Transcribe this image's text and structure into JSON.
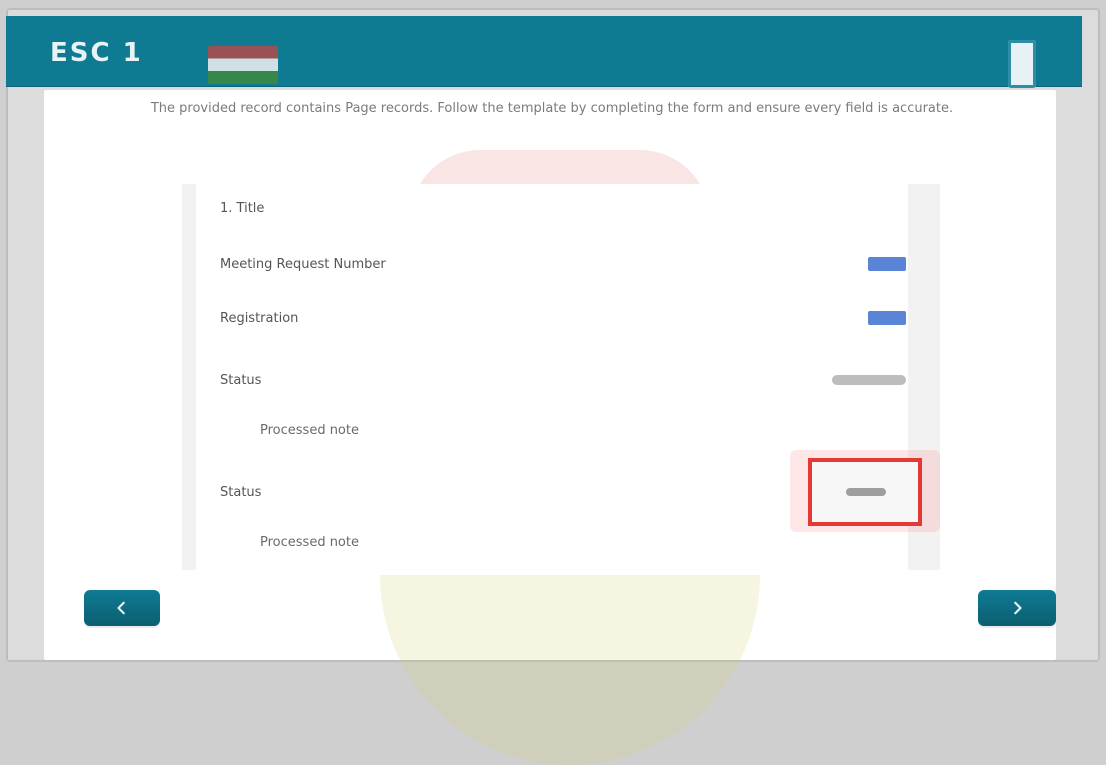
{
  "header": {
    "title": "ESC 1",
    "flag_icon": "flag-icon",
    "right_icon": "document-icon"
  },
  "instruction": {
    "text": "The provided record contains Page records. Follow the template by completing the form and ensure every field is accurate."
  },
  "form": {
    "items": [
      {
        "label": "1. Title",
        "value_type": "none"
      },
      {
        "label": "Meeting Request Number",
        "value_type": "pill",
        "value": ""
      },
      {
        "label": "Registration",
        "value_type": "pill",
        "value": ""
      },
      {
        "label": "Status",
        "value_type": "line",
        "value": ""
      },
      {
        "label": "Processed note",
        "value_type": "none",
        "indent": true
      },
      {
        "label": "Status",
        "value_type": "line",
        "value": "",
        "highlighted": true
      },
      {
        "label": "Processed note",
        "value_type": "none",
        "indent": true
      }
    ]
  },
  "nav": {
    "prev_label": "",
    "next_label": ""
  },
  "colors": {
    "accent": "#0f7b93",
    "highlight": "#e53935",
    "field_blue": "#5a84d6"
  }
}
